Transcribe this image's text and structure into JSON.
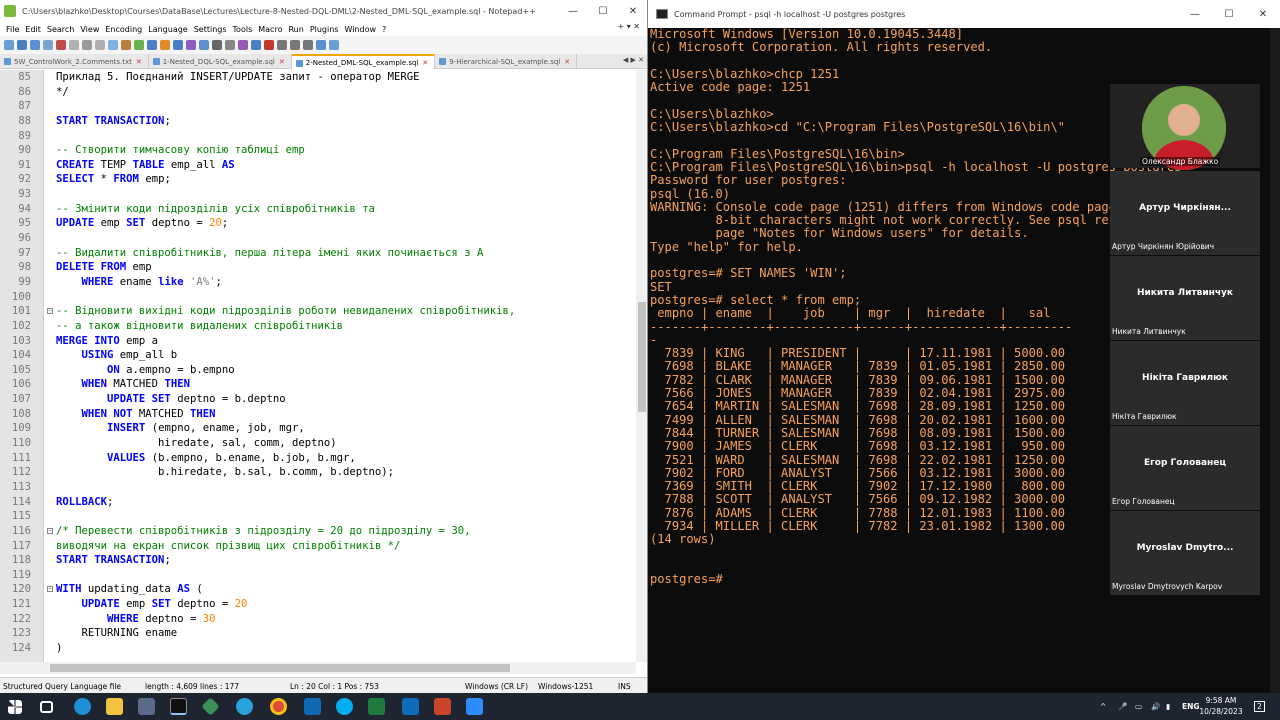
{
  "npp": {
    "title": "C:\\Users\\blazhko\\Desktop\\Courses\\DataBase\\Lectures\\Lecture-8-Nested-DQL-DML\\2-Nested_DML-SQL_example.sql - Notepad++",
    "menu": [
      "File",
      "Edit",
      "Search",
      "View",
      "Encoding",
      "Language",
      "Settings",
      "Tools",
      "Macro",
      "Run",
      "Plugins",
      "Window",
      "?"
    ],
    "menu_right": "+ ▾ ✕",
    "tabs": [
      {
        "label": "5W_ControlWork_2.Comments.txt",
        "active": false
      },
      {
        "label": "1-Nested_DQL-SQL_example.sql",
        "active": false
      },
      {
        "label": "2-Nested_DML-SQL_example.sql",
        "active": true
      },
      {
        "label": "9-Hierarchical-SQL_example.sql",
        "active": false
      }
    ],
    "code_lines": [
      {
        "n": "85",
        "fold": "",
        "parts": [
          [
            "plain",
            "Приклад 5. Поєднаний INSERT/UPDATE запит - оператор MERGE"
          ]
        ]
      },
      {
        "n": "86",
        "fold": "",
        "parts": [
          [
            "plain",
            "*/"
          ]
        ]
      },
      {
        "n": "87",
        "fold": "",
        "parts": []
      },
      {
        "n": "88",
        "fold": "",
        "parts": [
          [
            "kw",
            "START TRANSACTION"
          ],
          [
            "plain",
            ";"
          ]
        ]
      },
      {
        "n": "89",
        "fold": "",
        "parts": []
      },
      {
        "n": "90",
        "fold": "",
        "parts": [
          [
            "cm",
            "-- Створити тимчасову копію таблиці emp"
          ]
        ]
      },
      {
        "n": "91",
        "fold": "",
        "parts": [
          [
            "kw",
            "CREATE"
          ],
          [
            "plain",
            " TEMP "
          ],
          [
            "kw",
            "TABLE"
          ],
          [
            "plain",
            " emp_all "
          ],
          [
            "kw",
            "AS"
          ]
        ]
      },
      {
        "n": "92",
        "fold": "",
        "parts": [
          [
            "kw",
            "SELECT"
          ],
          [
            "plain",
            " * "
          ],
          [
            "kw",
            "FROM"
          ],
          [
            "plain",
            " emp;"
          ]
        ]
      },
      {
        "n": "93",
        "fold": "",
        "parts": []
      },
      {
        "n": "94",
        "fold": "",
        "parts": [
          [
            "cm",
            "-- Змінити коди підрозділів усіх співробітників та"
          ]
        ]
      },
      {
        "n": "95",
        "fold": "",
        "parts": [
          [
            "kw",
            "UPDATE"
          ],
          [
            "plain",
            " emp "
          ],
          [
            "kw",
            "SET"
          ],
          [
            "plain",
            " deptno = "
          ],
          [
            "num",
            "20"
          ],
          [
            "plain",
            ";"
          ]
        ]
      },
      {
        "n": "96",
        "fold": "",
        "parts": []
      },
      {
        "n": "97",
        "fold": "",
        "parts": [
          [
            "cm",
            "-- Видалити співробітників, перша літера імені яких починається з А"
          ]
        ]
      },
      {
        "n": "98",
        "fold": "",
        "parts": [
          [
            "kw",
            "DELETE FROM"
          ],
          [
            "plain",
            " emp"
          ]
        ]
      },
      {
        "n": "99",
        "fold": "",
        "parts": [
          [
            "plain",
            "    "
          ],
          [
            "kw",
            "WHERE"
          ],
          [
            "plain",
            " ename "
          ],
          [
            "kw",
            "like"
          ],
          [
            "plain",
            " "
          ],
          [
            "st",
            "'A%'"
          ],
          [
            "plain",
            ";"
          ]
        ]
      },
      {
        "n": "100",
        "fold": "",
        "parts": []
      },
      {
        "n": "101",
        "fold": "-",
        "parts": [
          [
            "cm",
            "-- Відновити вихідні коди підрозділів роботи невидалених співробітників,"
          ]
        ]
      },
      {
        "n": "102",
        "fold": "",
        "parts": [
          [
            "cm",
            "-- а також відновити видалених співробітників"
          ]
        ]
      },
      {
        "n": "103",
        "fold": "",
        "parts": [
          [
            "kw",
            "MERGE INTO"
          ],
          [
            "plain",
            " emp a"
          ]
        ]
      },
      {
        "n": "104",
        "fold": "",
        "parts": [
          [
            "plain",
            "    "
          ],
          [
            "kw",
            "USING"
          ],
          [
            "plain",
            " emp_all b"
          ]
        ]
      },
      {
        "n": "105",
        "fold": "",
        "parts": [
          [
            "plain",
            "        "
          ],
          [
            "kw",
            "ON"
          ],
          [
            "plain",
            " a.empno = b.empno"
          ]
        ]
      },
      {
        "n": "106",
        "fold": "",
        "parts": [
          [
            "plain",
            "    "
          ],
          [
            "kw",
            "WHEN"
          ],
          [
            "plain",
            " MATCHED "
          ],
          [
            "kw",
            "THEN"
          ]
        ]
      },
      {
        "n": "107",
        "fold": "",
        "parts": [
          [
            "plain",
            "        "
          ],
          [
            "kw",
            "UPDATE SET"
          ],
          [
            "plain",
            " deptno = b.deptno"
          ]
        ]
      },
      {
        "n": "108",
        "fold": "",
        "parts": [
          [
            "plain",
            "    "
          ],
          [
            "kw",
            "WHEN NOT"
          ],
          [
            "plain",
            " MATCHED "
          ],
          [
            "kw",
            "THEN"
          ]
        ]
      },
      {
        "n": "109",
        "fold": "",
        "parts": [
          [
            "plain",
            "        "
          ],
          [
            "kw",
            "INSERT"
          ],
          [
            "plain",
            " (empno, ename, job, mgr,"
          ]
        ]
      },
      {
        "n": "110",
        "fold": "",
        "parts": [
          [
            "plain",
            "                hiredate, sal, comm, deptno)"
          ]
        ]
      },
      {
        "n": "111",
        "fold": "",
        "parts": [
          [
            "plain",
            "        "
          ],
          [
            "kw",
            "VALUES"
          ],
          [
            "plain",
            " (b.empno, b.ename, b.job, b.mgr,"
          ]
        ]
      },
      {
        "n": "112",
        "fold": "",
        "parts": [
          [
            "plain",
            "                b.hiredate, b.sal, b.comm, b.deptno);"
          ]
        ]
      },
      {
        "n": "113",
        "fold": "",
        "parts": []
      },
      {
        "n": "114",
        "fold": "",
        "parts": [
          [
            "kw",
            "ROLLBACK"
          ],
          [
            "plain",
            ";"
          ]
        ]
      },
      {
        "n": "115",
        "fold": "",
        "parts": []
      },
      {
        "n": "116",
        "fold": "-",
        "parts": [
          [
            "cm",
            "/* Перевести співробітників з підрозділу = 20 до підрозділу = 30,"
          ]
        ]
      },
      {
        "n": "117",
        "fold": "",
        "parts": [
          [
            "cm",
            "виводячи на екран список прізвищ цих співробітників */"
          ]
        ]
      },
      {
        "n": "118",
        "fold": "",
        "parts": [
          [
            "kw",
            "START TRANSACTION"
          ],
          [
            "plain",
            ";"
          ]
        ]
      },
      {
        "n": "119",
        "fold": "",
        "parts": []
      },
      {
        "n": "120",
        "fold": "-",
        "parts": [
          [
            "kw",
            "WITH"
          ],
          [
            "plain",
            " updating_data "
          ],
          [
            "kw",
            "AS"
          ],
          [
            "plain",
            " ("
          ]
        ]
      },
      {
        "n": "121",
        "fold": "",
        "parts": [
          [
            "plain",
            "    "
          ],
          [
            "kw",
            "UPDATE"
          ],
          [
            "plain",
            " emp "
          ],
          [
            "kw",
            "SET"
          ],
          [
            "plain",
            " deptno = "
          ],
          [
            "num",
            "20"
          ]
        ]
      },
      {
        "n": "122",
        "fold": "",
        "parts": [
          [
            "plain",
            "        "
          ],
          [
            "kw",
            "WHERE"
          ],
          [
            "plain",
            " deptno = "
          ],
          [
            "num",
            "30"
          ]
        ]
      },
      {
        "n": "123",
        "fold": "",
        "parts": [
          [
            "plain",
            "    RETURNING ename"
          ]
        ]
      },
      {
        "n": "124",
        "fold": "",
        "parts": [
          [
            "plain",
            ")"
          ]
        ]
      }
    ],
    "status": {
      "filetype": "Structured Query Language file",
      "length": "length : 4,609",
      "lines": "lines : 177",
      "position": "Ln : 20    Col : 1    Pos : 753",
      "eol": "Windows (CR LF)",
      "encoding": "Windows-1251",
      "mode": "INS"
    }
  },
  "cmd": {
    "title": "Command Prompt - psql -h localhost -U postgres postgres",
    "lines": [
      "Microsoft Windows [Version 10.0.19045.3448]",
      "(c) Microsoft Corporation. All rights reserved.",
      "",
      "C:\\Users\\blazhko>chcp 1251",
      "Active code page: 1251",
      "",
      "C:\\Users\\blazhko>",
      "C:\\Users\\blazhko>cd \"C:\\Program Files\\PostgreSQL\\16\\bin\\\"",
      "",
      "C:\\Program Files\\PostgreSQL\\16\\bin>",
      "C:\\Program Files\\PostgreSQL\\16\\bin>psql -h localhost -U postgres postgres",
      "Password for user postgres:",
      "psql (16.0)",
      "WARNING: Console code page (1251) differs from Windows code page (866)",
      "         8-bit characters might not work correctly. See psql reference",
      "         page \"Notes for Windows users\" for details.",
      "Type \"help\" for help.",
      "",
      "postgres=# SET NAMES 'WIN';",
      "SET",
      "postgres=# select * from emp;",
      " empno | ename  |    job    | mgr  |  hiredate  |   sal",
      "-------+--------+-----------+------+------------+---------",
      "-",
      "  7839 | KING   | PRESIDENT |      | 17.11.1981 | 5000.00",
      "  7698 | BLAKE  | MANAGER   | 7839 | 01.05.1981 | 2850.00",
      "  7782 | CLARK  | MANAGER   | 7839 | 09.06.1981 | 1500.00",
      "  7566 | JONES  | MANAGER   | 7839 | 02.04.1981 | 2975.00",
      "  7654 | MARTIN | SALESMAN  | 7698 | 28.09.1981 | 1250.00",
      "  7499 | ALLEN  | SALESMAN  | 7698 | 20.02.1981 | 1600.00",
      "  7844 | TURNER | SALESMAN  | 7698 | 08.09.1981 | 1500.00",
      "  7900 | JAMES  | CLERK     | 7698 | 03.12.1981 |  950.00",
      "  7521 | WARD   | SALESMAN  | 7698 | 22.02.1981 | 1250.00",
      "  7902 | FORD   | ANALYST   | 7566 | 03.12.1981 | 3000.00",
      "  7369 | SMITH  | CLERK     | 7902 | 17.12.1980 |  800.00",
      "  7788 | SCOTT  | ANALYST   | 7566 | 09.12.1982 | 3000.00",
      "  7876 | ADAMS  | CLERK     | 7788 | 12.01.1983 | 1100.00",
      "  7934 | MILLER | CLERK     | 7782 | 23.01.1982 | 1300.00",
      "(14 rows)",
      "",
      "",
      "postgres=#"
    ]
  },
  "participants": [
    {
      "name": "",
      "sub": "Олександр Блажко",
      "video": true
    },
    {
      "name": "Артур Чиркінян...",
      "sub": "Артур Чиркінян Юрійович",
      "video": false
    },
    {
      "name": "Никита Литвинчук",
      "sub": "Никита Литвинчук",
      "video": false
    },
    {
      "name": "Нікіта Гаврилюк",
      "sub": "Нікіта Гаврилюк",
      "video": false
    },
    {
      "name": "Егор Голованец",
      "sub": "Егор Голованец",
      "video": false
    },
    {
      "name": "Myroslav  Dmytro...",
      "sub": "Myroslav Dmytrovych Karpov",
      "video": false
    }
  ],
  "taskbar": {
    "lang": "ENG",
    "time": "9:58 AM",
    "date": "10/28/2023",
    "notifications": "2"
  }
}
